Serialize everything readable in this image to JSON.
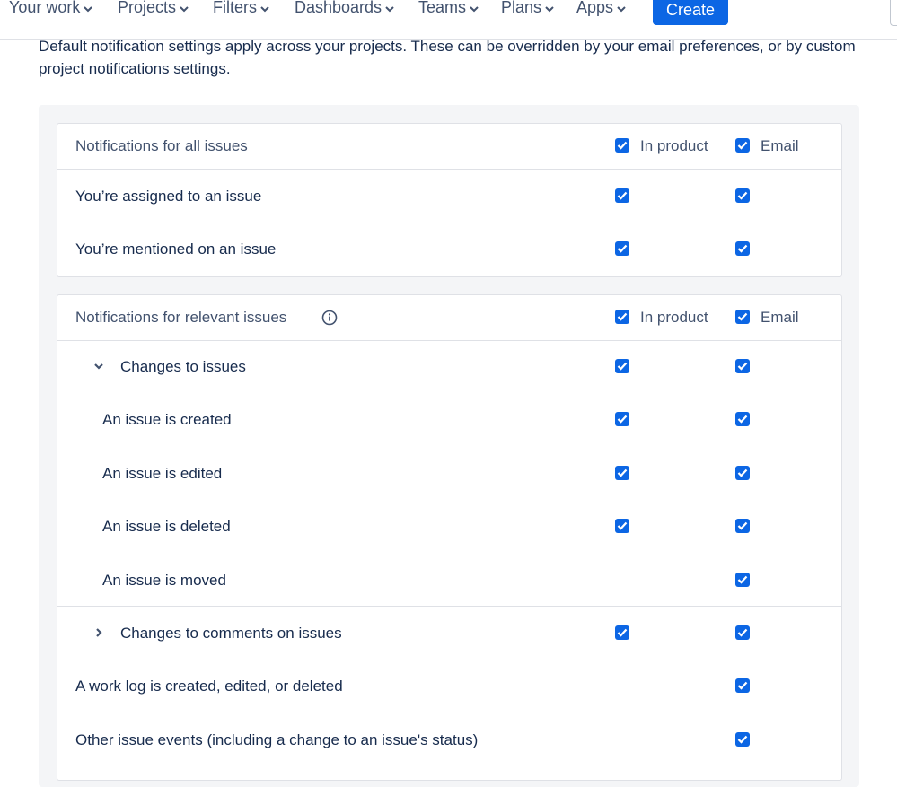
{
  "nav": {
    "items": [
      {
        "label": "Your work"
      },
      {
        "label": "Projects"
      },
      {
        "label": "Filters"
      },
      {
        "label": "Dashboards"
      },
      {
        "label": "Teams"
      },
      {
        "label": "Plans"
      },
      {
        "label": "Apps"
      }
    ],
    "create_label": "Create"
  },
  "intro_text": "Default notification settings apply across your projects. These can be overridden by your email preferences, or by custom project notifications settings.",
  "all_issues": {
    "header": "Notifications for all issues",
    "in_product_label": "In product",
    "email_label": "Email",
    "rows": [
      {
        "label": "You’re assigned to an issue",
        "in_product": true,
        "email": true
      },
      {
        "label": "You’re mentioned on an issue",
        "in_product": true,
        "email": true
      }
    ]
  },
  "relevant_issues": {
    "header": "Notifications for relevant issues",
    "in_product_label": "In product",
    "email_label": "Email",
    "info_icon": "info-icon",
    "changes_group": {
      "label": "Changes to issues",
      "expanded": true,
      "in_product": true,
      "email": true
    },
    "change_rows": [
      {
        "label": "An issue is created",
        "in_product": true,
        "email": true
      },
      {
        "label": "An issue is edited",
        "in_product": true,
        "email": true
      },
      {
        "label": "An issue is deleted",
        "in_product": true,
        "email": true
      },
      {
        "label": "An issue is moved",
        "in_product": false,
        "email": true
      }
    ],
    "comments_group": {
      "label": "Changes to comments on issues",
      "expanded": false,
      "in_product": true,
      "email": true
    },
    "other_rows": [
      {
        "label": "A work log is created, edited, or deleted",
        "in_product": false,
        "email": true
      },
      {
        "label": "Other issue events (including a change to an issue's status)",
        "in_product": false,
        "email": true
      }
    ]
  },
  "colors": {
    "accent": "#0c66e4",
    "text": "#172b4d",
    "subtle_text": "#42526e",
    "panel_bg": "#f4f5f7"
  }
}
